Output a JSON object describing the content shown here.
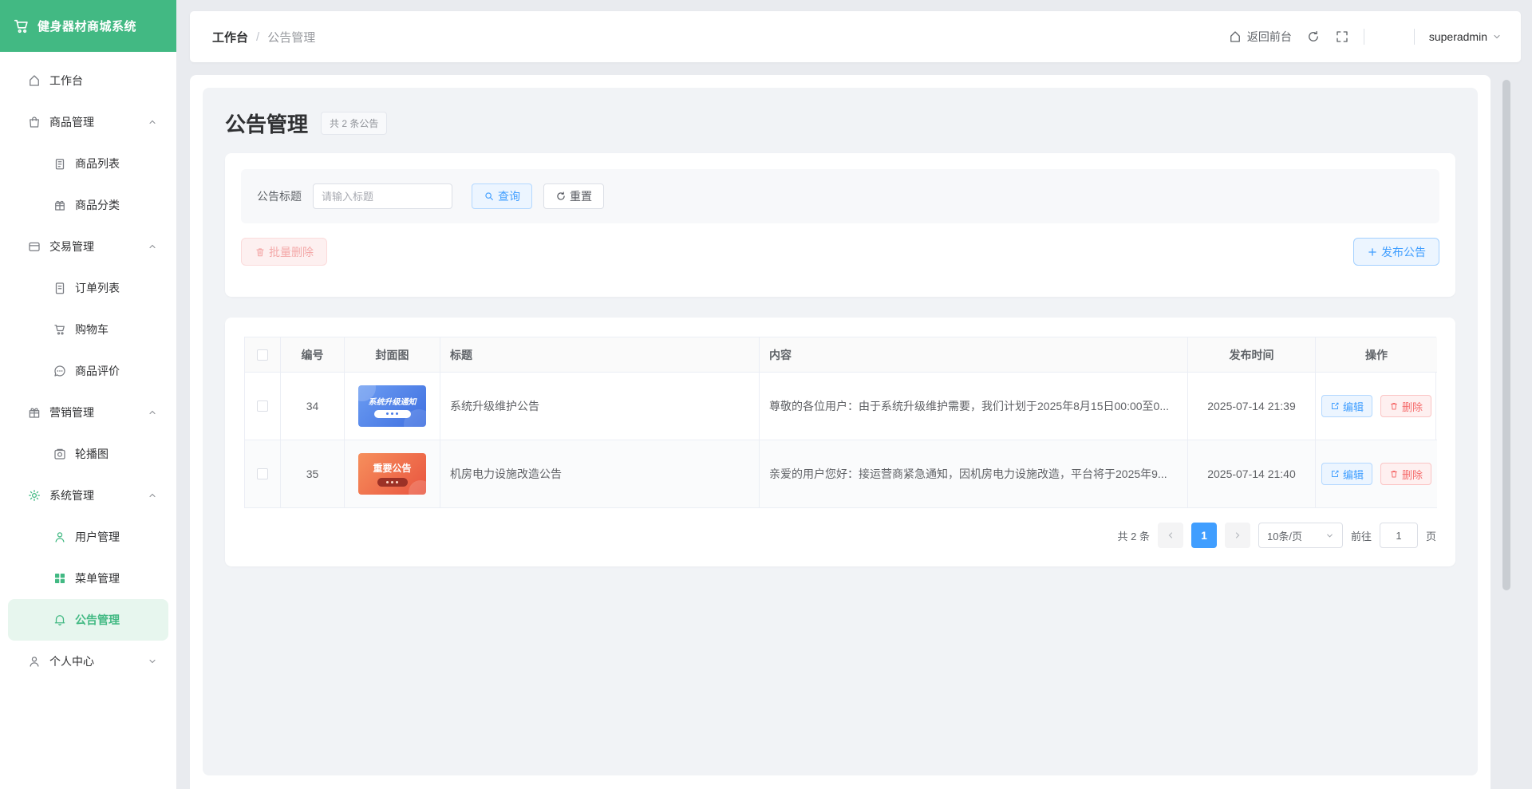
{
  "app": {
    "logo_title": "健身器材商城系统"
  },
  "sidebar": {
    "items": [
      {
        "label": "工作台"
      },
      {
        "label": "商品管理"
      },
      {
        "label": "商品列表"
      },
      {
        "label": "商品分类"
      },
      {
        "label": "交易管理"
      },
      {
        "label": "订单列表"
      },
      {
        "label": "购物车"
      },
      {
        "label": "商品评价"
      },
      {
        "label": "营销管理"
      },
      {
        "label": "轮播图"
      },
      {
        "label": "系统管理"
      },
      {
        "label": "用户管理"
      },
      {
        "label": "菜单管理"
      },
      {
        "label": "公告管理"
      },
      {
        "label": "个人中心"
      }
    ]
  },
  "header": {
    "breadcrumb": {
      "first": "工作台",
      "separator": "/",
      "second": "公告管理"
    },
    "back_front_label": "返回前台",
    "username": "superadmin"
  },
  "page": {
    "title": "公告管理",
    "count_badge": "共 2 条公告"
  },
  "filter": {
    "label": "公告标题",
    "placeholder": "请输入标题",
    "query_label": "查询",
    "reset_label": "重置",
    "batch_delete_label": "批量删除",
    "publish_label": "发布公告"
  },
  "table": {
    "headers": {
      "id": "编号",
      "cover": "封面图",
      "title": "标题",
      "content": "内容",
      "time": "发布时间",
      "action": "操作"
    },
    "edit_label": "编辑",
    "delete_label": "删除",
    "rows": [
      {
        "id": "34",
        "cover_title": "系统升级通知",
        "title": "系统升级维护公告",
        "content": "尊敬的各位用户：由于系统升级维护需要，我们计划于2025年8月15日00:00至0...",
        "time": "2025-07-14 21:39"
      },
      {
        "id": "35",
        "cover_title": "重要公告",
        "title": "机房电力设施改造公告",
        "content": "亲爱的用户您好：接运营商紧急通知，因机房电力设施改造，平台将于2025年9...",
        "time": "2025-07-14 21:40"
      }
    ]
  },
  "pagination": {
    "total": "共 2 条",
    "current_page": "1",
    "page_size": "10条/页",
    "goto_label": "前往",
    "goto_value": "1",
    "goto_suffix": "页"
  },
  "colors": {
    "brand_green": "#42b983",
    "accent_blue": "#409eff",
    "danger_red": "#f56c6c",
    "page_bg": "#e9ebef",
    "panel_bg": "#f1f3f6"
  }
}
